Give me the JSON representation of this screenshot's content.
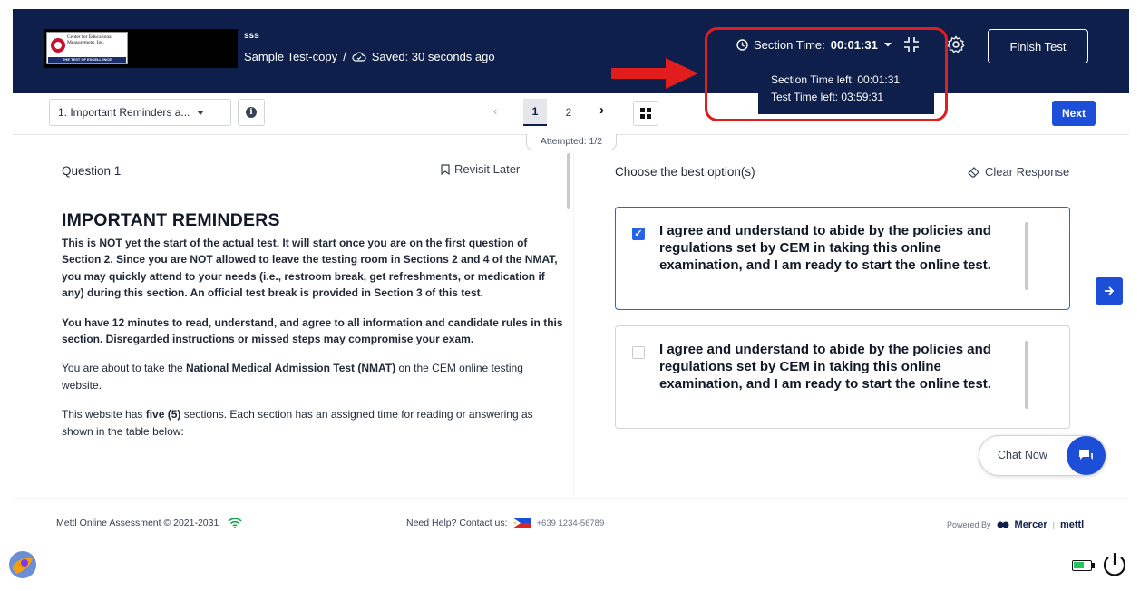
{
  "header": {
    "logo": {
      "org_name": "Center for Educational Measurement, Inc.",
      "tagline": "THE TEST OF EXCELLENCE"
    },
    "test_subtitle": "sss",
    "test_title": "Sample Test-copy",
    "separator": "/",
    "saved_status": "Saved: 30 seconds ago",
    "section_time_label": "Section Time:",
    "section_time_value": "00:01:31",
    "finish_label": "Finish Test",
    "time_popup": {
      "section_left": "Section Time left: 00:01:31",
      "test_left": "Test Time left: 03:59:31"
    }
  },
  "toolbar": {
    "section_select": "1. Important Reminders a...",
    "pages": [
      "1",
      "2"
    ],
    "current_page": "1",
    "next_label": "Next",
    "attempted": "Attempted: 1/2"
  },
  "question": {
    "label": "Question 1",
    "revisit_label": "Revisit Later",
    "heading": "IMPORTANT REMINDERS",
    "para1": "This is NOT yet the start of the actual test. It will start once you are on the first question of Section 2. Since you are NOT allowed to leave the testing room in Sections 2 and 4 of the NMAT, you may quickly attend to your needs (i.e., restroom break, get refreshments, or medication if any) during this section. An official test break is provided in Section 3 of this test.",
    "para2": "You have 12 minutes to read, understand, and agree to all information and candidate rules in this section. Disregarded instructions or missed steps may compromise your exam.",
    "para3_pre": "You are about to take the ",
    "para3_bold": "National Medical Admission Test (NMAT)",
    "para3_post": " on the CEM online testing website.",
    "para4_pre": "This website has ",
    "para4_bold": "five (5)",
    "para4_post": " sections. Each section has an assigned time for reading or answering as shown in the table below:"
  },
  "answer": {
    "prompt": "Choose the best option(s)",
    "clear_label": "Clear Response",
    "options": [
      {
        "text": "I agree and understand to abide by the policies and regulations set by CEM in taking this online examination, and I am ready to start the online test.",
        "checked": true
      },
      {
        "text": "I agree and understand to abide by the policies and regulations set by CEM in taking this online examination, and I am ready to start the online test.",
        "checked": false
      }
    ]
  },
  "chat": {
    "label": "Chat Now"
  },
  "footer": {
    "copyright": "Mettl Online Assessment © 2021-2031",
    "help_label": "Need Help? Contact us:",
    "phone": "+639 1234-56789",
    "powered_by": "Powered By",
    "brand1": "Mercer",
    "brand2": "mettl"
  },
  "colors": {
    "header_bg": "#0d1f4a",
    "accent": "#1d4ed8",
    "highlight": "#e11d1d"
  }
}
